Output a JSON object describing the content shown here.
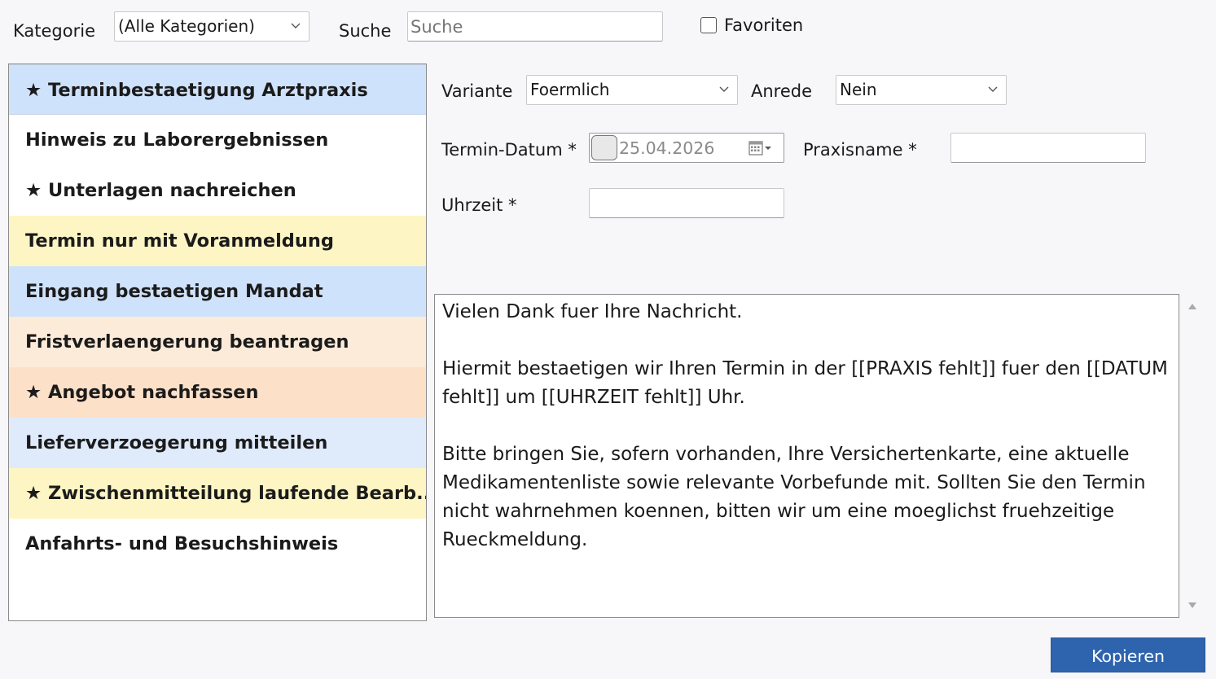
{
  "toolbar": {
    "category_label": "Kategorie",
    "category_value": "(Alle Kategorien)",
    "search_label": "Suche",
    "search_placeholder": "Suche",
    "search_value": "",
    "favorites_label": "Favoriten",
    "favorites_checked": false
  },
  "templates": [
    {
      "label": "★ Terminbestaetigung Arztpraxis",
      "bg": "#cfe2fb",
      "selected": true
    },
    {
      "label": "Hinweis zu Laborergebnissen",
      "bg": "#ffffff"
    },
    {
      "label": "★ Unterlagen nachreichen",
      "bg": "#ffffff"
    },
    {
      "label": "Termin nur mit Voranmeldung",
      "bg": "#fdf5c4"
    },
    {
      "label": "Eingang bestaetigen Mandat",
      "bg": "#cfe2fb"
    },
    {
      "label": "Fristverlaengerung beantragen",
      "bg": "#fdebd9"
    },
    {
      "label": "★ Angebot nachfassen",
      "bg": "#fde0c8"
    },
    {
      "label": "Lieferverzoegerung mitteilen",
      "bg": "#dfeafb"
    },
    {
      "label": "★ Zwischenmitteilung laufende Bearb...",
      "bg": "#fdf5c4"
    },
    {
      "label": "Anfahrts- und Besuchshinweis",
      "bg": "#ffffff"
    }
  ],
  "form": {
    "variant_label": "Variante",
    "variant_value": "Foermlich",
    "salutation_label": "Anrede",
    "salutation_value": "Nein",
    "date_label": "Termin-Datum *",
    "date_value": "25.04.2026",
    "practice_label": "Praxisname *",
    "practice_value": "",
    "time_label": "Uhrzeit *",
    "time_value": ""
  },
  "message": {
    "text": "Vielen Dank fuer Ihre Nachricht.\n\nHiermit bestaetigen wir Ihren Termin in der [[PRAXIS fehlt]] fuer den [[DATUM fehlt]] um [[UHRZEIT fehlt]] Uhr.\n\nBitte bringen Sie, sofern vorhanden, Ihre Versichertenkarte, eine aktuelle Medikamentenliste sowie relevante Vorbefunde mit. Sollten Sie den Termin nicht wahrnehmen koennen, bitten wir um eine moeglichst fruehzeitige Rueckmeldung."
  },
  "actions": {
    "copy_label": "Kopieren"
  },
  "colors": {
    "accent": "#2e64ad"
  },
  "icons": {
    "dropdown": "chevron-down-icon",
    "calendar": "calendar-icon",
    "scroll_up": "scroll-up-arrow-icon",
    "scroll_down": "scroll-down-arrow-icon"
  }
}
